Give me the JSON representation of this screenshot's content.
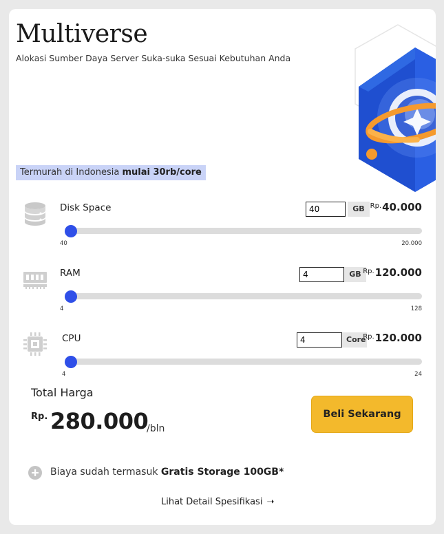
{
  "header": {
    "title": "Multiverse",
    "subtitle": "Alokasi Sumber Daya Server Suka-suka Sesuai Kebutuhan Anda"
  },
  "promo": {
    "text": "Termurah di Indonesia ",
    "highlight": "mulai 30rb/core"
  },
  "resources": [
    {
      "id": "disk",
      "label": "Disk Space",
      "icon": "database-icon",
      "value": "40",
      "unit": "GB",
      "currency": "Rp.",
      "price": "40.000",
      "min_label": "40",
      "max_label": "20.000",
      "slider_fraction": 0
    },
    {
      "id": "ram",
      "label": "RAM",
      "icon": "memory-icon",
      "value": "4",
      "unit": "GB",
      "currency": "Rp.",
      "price": "120.000",
      "min_label": "4",
      "max_label": "128",
      "slider_fraction": 0
    },
    {
      "id": "cpu",
      "label": "CPU",
      "icon": "cpu-icon",
      "value": "4",
      "unit": "Core",
      "currency": "Rp.",
      "price": "120.000",
      "min_label": "4",
      "max_label": "24",
      "slider_fraction": 0
    }
  ],
  "total": {
    "label": "Total Harga",
    "currency": "Rp.",
    "value": "280.000",
    "period": "/bln"
  },
  "buy_button": "Beli Sekarang",
  "note": {
    "icon": "plus-circle-icon",
    "text": "Biaya sudah termasuk ",
    "highlight": "Gratis Storage 100GB*"
  },
  "detail_link": "Lihat Detail Spesifikasi",
  "colors": {
    "accent": "#2f4fe8",
    "button": "#f3b92c",
    "promo_bg": "#c9d3f7",
    "track": "#dcdcdc"
  }
}
